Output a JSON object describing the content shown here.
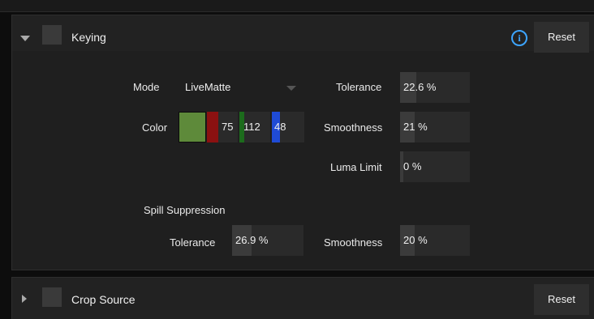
{
  "keying": {
    "title": "Keying",
    "reset_label": "Reset",
    "info_glyph": "i",
    "mode": {
      "label": "Mode",
      "value": "LiveMatte"
    },
    "color": {
      "label": "Color",
      "swatch_hex": "#5e8a3a",
      "r": "75",
      "g": "112",
      "b": "48",
      "r_color": "#8b1111",
      "g_color": "#1c6b1c",
      "b_color": "#1f4bd6"
    },
    "tolerance": {
      "label": "Tolerance",
      "value": "22.6 %",
      "fill_fraction": 0.226
    },
    "smoothness": {
      "label": "Smoothness",
      "value": "21 %",
      "fill_fraction": 0.21
    },
    "luma_limit": {
      "label": "Luma Limit",
      "value": "0 %",
      "fill_fraction": 0.0
    },
    "spill": {
      "heading": "Spill Suppression",
      "tolerance": {
        "label": "Tolerance",
        "value": "26.9 %",
        "fill_fraction": 0.269
      },
      "smoothness": {
        "label": "Smoothness",
        "value": "20 %",
        "fill_fraction": 0.2
      }
    }
  },
  "crop": {
    "title": "Crop Source",
    "reset_label": "Reset"
  },
  "colors": {
    "accent_info": "#3da5ff",
    "panel_bg": "#1f1f1f",
    "field_bg": "#2a2a2a"
  }
}
